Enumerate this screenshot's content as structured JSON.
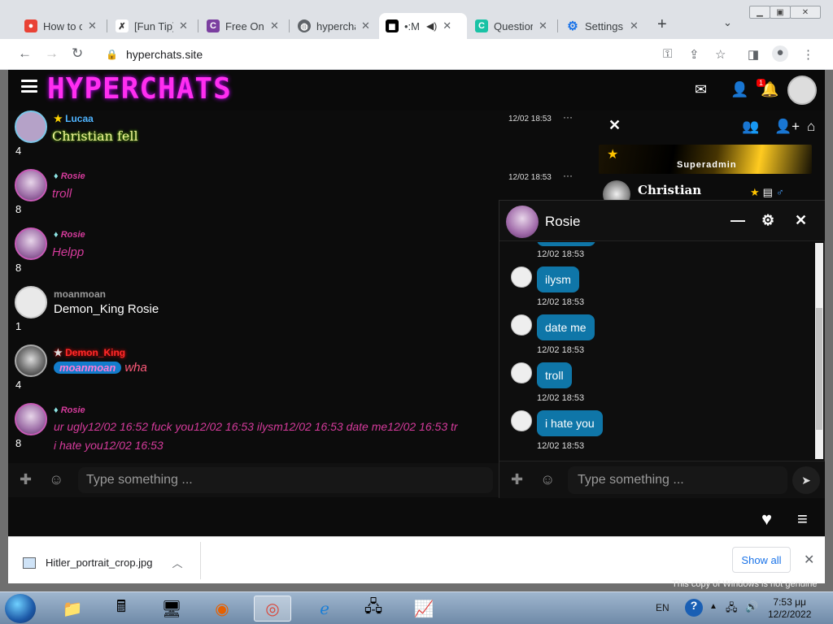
{
  "browser": {
    "tabs": [
      {
        "title": "How to c",
        "icon_color": "#e94235",
        "icon": "globe-icon"
      },
      {
        "title": "[Fun Tip]",
        "icon_color": "#333333",
        "icon": "x-logo-icon"
      },
      {
        "title": "Free Onl",
        "icon_color": "#7b3fa0",
        "icon": "c-logo-icon"
      },
      {
        "title": "hyperchat",
        "icon_color": "#5f6368",
        "icon": "globe-icon"
      },
      {
        "title": "•:M",
        "icon_color": "#000000",
        "icon": "chat-icon",
        "active": true
      },
      {
        "title": "Question",
        "icon_color": "#19c2a5",
        "icon": "c-logo-icon"
      },
      {
        "title": "Settings",
        "icon_color": "#1a73e8",
        "icon": "gear-icon"
      }
    ],
    "url": "hyperchats.site"
  },
  "site": {
    "logo": "HYPERCHATS",
    "notification_count": "1"
  },
  "messages": [
    {
      "user": "Lucaa",
      "user_color": "#4fb4ff",
      "rank": "star",
      "text": "Christian fell",
      "text_color": "#f1f39a",
      "time": "12/02 18:53",
      "count": "4"
    },
    {
      "user": "Rosie",
      "user_color": "#d63b9c",
      "rank": "diamond",
      "text": "troll",
      "text_color": "#d63b9c",
      "time": "12/02 18:53",
      "count": "8"
    },
    {
      "user": "Rosie",
      "user_color": "#d63b9c",
      "rank": "diamond",
      "text": "Helpp",
      "text_color": "#d63b9c",
      "time": "",
      "count": "8"
    },
    {
      "user": "moanmoan",
      "user_color": "#9a9a9a",
      "rank": "",
      "text": "Demon_King Rosie",
      "text_color": "#ffffff",
      "time": "",
      "count": "1"
    },
    {
      "user": "Demon_King",
      "user_color": "#ff2a2a",
      "rank": "star",
      "mention": "moanmoan",
      "text": "wha",
      "text_color": "#ff5a7a",
      "time": "",
      "count": "4"
    },
    {
      "user": "Rosie",
      "user_color": "#d63b9c",
      "rank": "diamond",
      "text": "ur ugly12/02 16:52 fuck you12/02 16:53 ilysm12/02 16:53 date me12/02 16:53 tr",
      "text2": "i hate you12/02 16:53",
      "text_color": "#d63b9c",
      "time": "",
      "count": "8"
    }
  ],
  "main_input": {
    "placeholder": "Type something ..."
  },
  "right_panel": {
    "rank_label": "Superadmin",
    "user": "Christian"
  },
  "private_chat": {
    "name": "Rosie",
    "messages": [
      {
        "text": "",
        "time": "12/02 18:53"
      },
      {
        "text": "ilysm",
        "time": "12/02 18:53"
      },
      {
        "text": "date me",
        "time": "12/02 18:53"
      },
      {
        "text": "troll",
        "time": "12/02 18:53"
      },
      {
        "text": "i hate you",
        "time": "12/02 18:53"
      }
    ],
    "placeholder": "Type something ..."
  },
  "downloads": {
    "file": "Hitler_portrait_crop.jpg",
    "show_all": "Show all"
  },
  "taskbar": {
    "lang": "EN",
    "time": "7:53 μμ",
    "date": "12/2/2022",
    "watermark": "This copy of Windows is not genuine"
  }
}
